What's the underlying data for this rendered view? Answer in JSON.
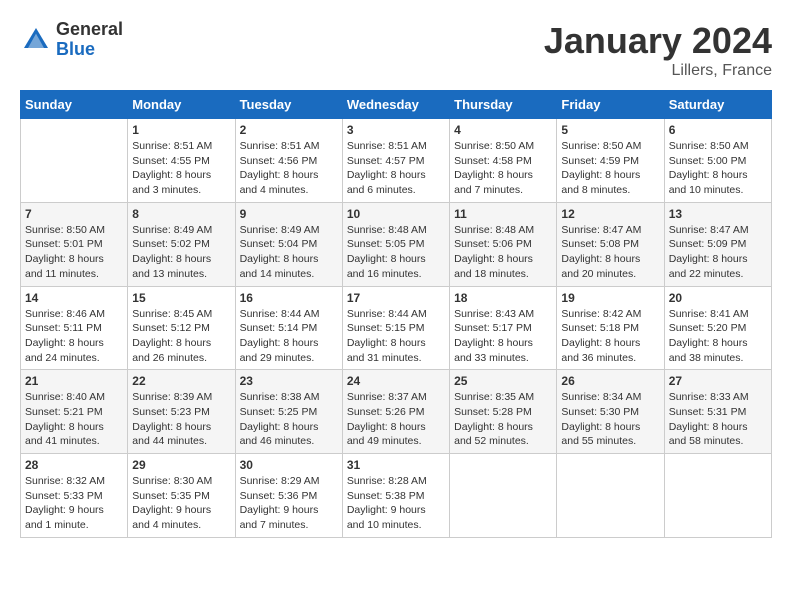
{
  "logo": {
    "general": "General",
    "blue": "Blue"
  },
  "title": "January 2024",
  "location": "Lillers, France",
  "weekdays": [
    "Sunday",
    "Monday",
    "Tuesday",
    "Wednesday",
    "Thursday",
    "Friday",
    "Saturday"
  ],
  "weeks": [
    [
      {
        "day": "",
        "sunrise": "",
        "sunset": "",
        "daylight": ""
      },
      {
        "day": "1",
        "sunrise": "Sunrise: 8:51 AM",
        "sunset": "Sunset: 4:55 PM",
        "daylight": "Daylight: 8 hours and 3 minutes."
      },
      {
        "day": "2",
        "sunrise": "Sunrise: 8:51 AM",
        "sunset": "Sunset: 4:56 PM",
        "daylight": "Daylight: 8 hours and 4 minutes."
      },
      {
        "day": "3",
        "sunrise": "Sunrise: 8:51 AM",
        "sunset": "Sunset: 4:57 PM",
        "daylight": "Daylight: 8 hours and 6 minutes."
      },
      {
        "day": "4",
        "sunrise": "Sunrise: 8:50 AM",
        "sunset": "Sunset: 4:58 PM",
        "daylight": "Daylight: 8 hours and 7 minutes."
      },
      {
        "day": "5",
        "sunrise": "Sunrise: 8:50 AM",
        "sunset": "Sunset: 4:59 PM",
        "daylight": "Daylight: 8 hours and 8 minutes."
      },
      {
        "day": "6",
        "sunrise": "Sunrise: 8:50 AM",
        "sunset": "Sunset: 5:00 PM",
        "daylight": "Daylight: 8 hours and 10 minutes."
      }
    ],
    [
      {
        "day": "7",
        "sunrise": "Sunrise: 8:50 AM",
        "sunset": "Sunset: 5:01 PM",
        "daylight": "Daylight: 8 hours and 11 minutes."
      },
      {
        "day": "8",
        "sunrise": "Sunrise: 8:49 AM",
        "sunset": "Sunset: 5:02 PM",
        "daylight": "Daylight: 8 hours and 13 minutes."
      },
      {
        "day": "9",
        "sunrise": "Sunrise: 8:49 AM",
        "sunset": "Sunset: 5:04 PM",
        "daylight": "Daylight: 8 hours and 14 minutes."
      },
      {
        "day": "10",
        "sunrise": "Sunrise: 8:48 AM",
        "sunset": "Sunset: 5:05 PM",
        "daylight": "Daylight: 8 hours and 16 minutes."
      },
      {
        "day": "11",
        "sunrise": "Sunrise: 8:48 AM",
        "sunset": "Sunset: 5:06 PM",
        "daylight": "Daylight: 8 hours and 18 minutes."
      },
      {
        "day": "12",
        "sunrise": "Sunrise: 8:47 AM",
        "sunset": "Sunset: 5:08 PM",
        "daylight": "Daylight: 8 hours and 20 minutes."
      },
      {
        "day": "13",
        "sunrise": "Sunrise: 8:47 AM",
        "sunset": "Sunset: 5:09 PM",
        "daylight": "Daylight: 8 hours and 22 minutes."
      }
    ],
    [
      {
        "day": "14",
        "sunrise": "Sunrise: 8:46 AM",
        "sunset": "Sunset: 5:11 PM",
        "daylight": "Daylight: 8 hours and 24 minutes."
      },
      {
        "day": "15",
        "sunrise": "Sunrise: 8:45 AM",
        "sunset": "Sunset: 5:12 PM",
        "daylight": "Daylight: 8 hours and 26 minutes."
      },
      {
        "day": "16",
        "sunrise": "Sunrise: 8:44 AM",
        "sunset": "Sunset: 5:14 PM",
        "daylight": "Daylight: 8 hours and 29 minutes."
      },
      {
        "day": "17",
        "sunrise": "Sunrise: 8:44 AM",
        "sunset": "Sunset: 5:15 PM",
        "daylight": "Daylight: 8 hours and 31 minutes."
      },
      {
        "day": "18",
        "sunrise": "Sunrise: 8:43 AM",
        "sunset": "Sunset: 5:17 PM",
        "daylight": "Daylight: 8 hours and 33 minutes."
      },
      {
        "day": "19",
        "sunrise": "Sunrise: 8:42 AM",
        "sunset": "Sunset: 5:18 PM",
        "daylight": "Daylight: 8 hours and 36 minutes."
      },
      {
        "day": "20",
        "sunrise": "Sunrise: 8:41 AM",
        "sunset": "Sunset: 5:20 PM",
        "daylight": "Daylight: 8 hours and 38 minutes."
      }
    ],
    [
      {
        "day": "21",
        "sunrise": "Sunrise: 8:40 AM",
        "sunset": "Sunset: 5:21 PM",
        "daylight": "Daylight: 8 hours and 41 minutes."
      },
      {
        "day": "22",
        "sunrise": "Sunrise: 8:39 AM",
        "sunset": "Sunset: 5:23 PM",
        "daylight": "Daylight: 8 hours and 44 minutes."
      },
      {
        "day": "23",
        "sunrise": "Sunrise: 8:38 AM",
        "sunset": "Sunset: 5:25 PM",
        "daylight": "Daylight: 8 hours and 46 minutes."
      },
      {
        "day": "24",
        "sunrise": "Sunrise: 8:37 AM",
        "sunset": "Sunset: 5:26 PM",
        "daylight": "Daylight: 8 hours and 49 minutes."
      },
      {
        "day": "25",
        "sunrise": "Sunrise: 8:35 AM",
        "sunset": "Sunset: 5:28 PM",
        "daylight": "Daylight: 8 hours and 52 minutes."
      },
      {
        "day": "26",
        "sunrise": "Sunrise: 8:34 AM",
        "sunset": "Sunset: 5:30 PM",
        "daylight": "Daylight: 8 hours and 55 minutes."
      },
      {
        "day": "27",
        "sunrise": "Sunrise: 8:33 AM",
        "sunset": "Sunset: 5:31 PM",
        "daylight": "Daylight: 8 hours and 58 minutes."
      }
    ],
    [
      {
        "day": "28",
        "sunrise": "Sunrise: 8:32 AM",
        "sunset": "Sunset: 5:33 PM",
        "daylight": "Daylight: 9 hours and 1 minute."
      },
      {
        "day": "29",
        "sunrise": "Sunrise: 8:30 AM",
        "sunset": "Sunset: 5:35 PM",
        "daylight": "Daylight: 9 hours and 4 minutes."
      },
      {
        "day": "30",
        "sunrise": "Sunrise: 8:29 AM",
        "sunset": "Sunset: 5:36 PM",
        "daylight": "Daylight: 9 hours and 7 minutes."
      },
      {
        "day": "31",
        "sunrise": "Sunrise: 8:28 AM",
        "sunset": "Sunset: 5:38 PM",
        "daylight": "Daylight: 9 hours and 10 minutes."
      },
      {
        "day": "",
        "sunrise": "",
        "sunset": "",
        "daylight": ""
      },
      {
        "day": "",
        "sunrise": "",
        "sunset": "",
        "daylight": ""
      },
      {
        "day": "",
        "sunrise": "",
        "sunset": "",
        "daylight": ""
      }
    ]
  ]
}
